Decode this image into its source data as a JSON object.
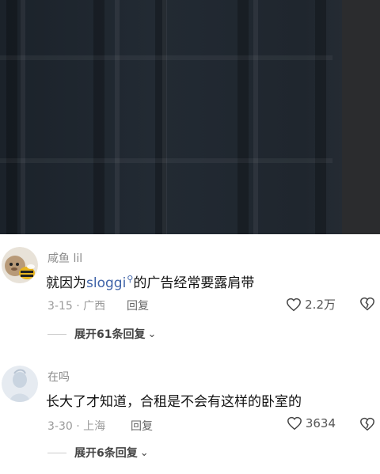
{
  "comments": [
    {
      "username": "咸鱼 lil",
      "text_before": "就因为",
      "link_text": "sloggi",
      "text_after": "的广告经常要露肩带",
      "date_location": "3-15 · 广西",
      "reply_label": "回复",
      "like_count": "2.2万",
      "expand_label": "展开61条回复"
    },
    {
      "username": "在吗",
      "text": "长大了才知道，合租是不会有这样的卧室的",
      "date_location": "3-30 · 上海",
      "reply_label": "回复",
      "like_count": "3634",
      "expand_label": "展开6条回复"
    }
  ],
  "colors": {
    "link": "#3f63a8",
    "meta": "#9a9a9a",
    "username": "#8a8a8a"
  }
}
